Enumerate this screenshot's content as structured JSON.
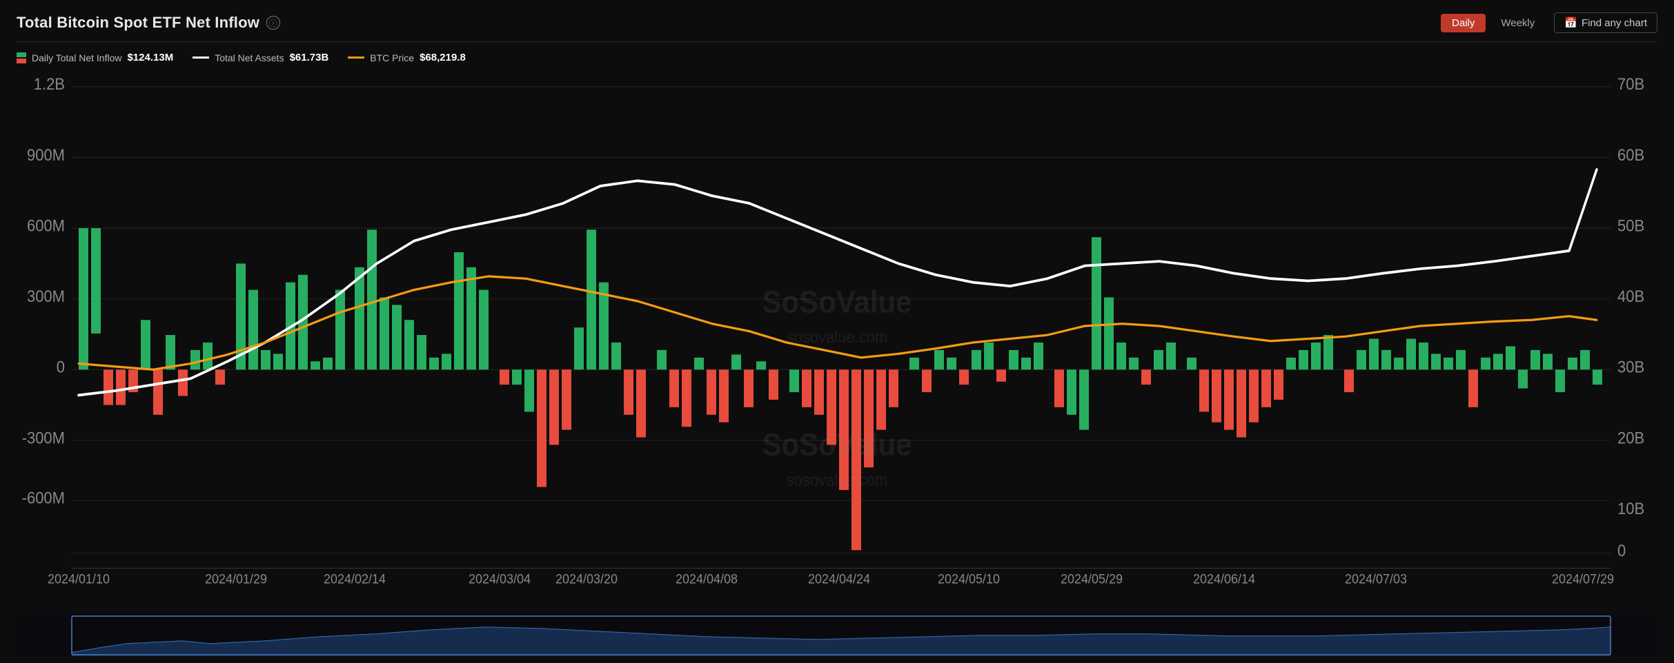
{
  "header": {
    "title": "Total Bitcoin Spot ETF Net Inflow",
    "info_tooltip": "Information"
  },
  "controls": {
    "tabs": [
      {
        "label": "Daily",
        "active": true
      },
      {
        "label": "Weekly",
        "active": false
      }
    ],
    "find_chart": {
      "label": "Find any chart",
      "icon": "calendar-icon"
    }
  },
  "legend": {
    "items": [
      {
        "type": "bar",
        "label": "Daily Total Net Inflow",
        "value": "$124.13M",
        "color_pos": "#27ae60",
        "color_neg": "#e74c3c"
      },
      {
        "type": "line",
        "label": "Total Net Assets",
        "value": "$61.73B",
        "color": "#ffffff"
      },
      {
        "type": "line",
        "label": "BTC Price",
        "value": "$68,219.8",
        "color": "#f39c12"
      }
    ]
  },
  "chart": {
    "y_axis_left": [
      "1.2B",
      "900M",
      "600M",
      "300M",
      "0",
      "-300M",
      "-600M"
    ],
    "y_axis_right": [
      "70B",
      "60B",
      "50B",
      "40B",
      "30B",
      "20B",
      "10B",
      "0B"
    ],
    "x_axis": [
      "2024/01/10",
      "2024/01/29",
      "2024/02/14",
      "2024/03/04",
      "2024/03/20",
      "2024/04/08",
      "2024/04/24",
      "2024/05/10",
      "2024/05/29",
      "2024/06/14",
      "2024/07/03",
      "2024/07/29"
    ],
    "watermark_text": "SoSoValue",
    "watermark_url": "sosovalue.com"
  }
}
